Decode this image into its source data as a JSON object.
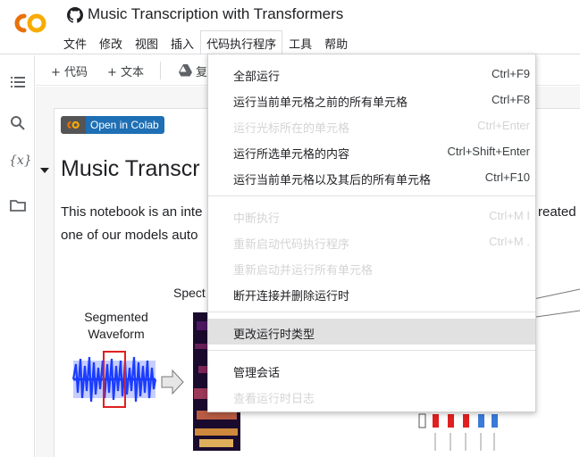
{
  "header": {
    "title": "Music Transcription with Transformers",
    "menu": [
      "文件",
      "修改",
      "视图",
      "插入",
      "代码执行程序",
      "工具",
      "帮助"
    ],
    "active_menu_index": 4
  },
  "toolbar": {
    "add_code": "+ 代码",
    "add_text": "+ 文本",
    "copy_to_drive": "复"
  },
  "rail": {
    "var_icon_text": "{x}"
  },
  "notebook": {
    "badge_text": "Open in Colab",
    "heading": "Music Transcr",
    "para_line1_left": "This notebook is an inte",
    "para_line1_right": "reated",
    "para_line2": "one of our models auto",
    "fig_label_segmented": "Segmented Waveform",
    "fig_label_spect": "Spect"
  },
  "dropdown": {
    "groups": [
      [
        {
          "label": "全部运行",
          "shortcut": "Ctrl+F9",
          "disabled": false
        },
        {
          "label": "运行当前单元格之前的所有单元格",
          "shortcut": "Ctrl+F8",
          "disabled": false
        },
        {
          "label": "运行光标所在的单元格",
          "shortcut": "Ctrl+Enter",
          "disabled": true
        },
        {
          "label": "运行所选单元格的内容",
          "shortcut": "Ctrl+Shift+Enter",
          "disabled": false
        },
        {
          "label": "运行当前单元格以及其后的所有单元格",
          "shortcut": "Ctrl+F10",
          "disabled": false
        }
      ],
      [
        {
          "label": "中断执行",
          "shortcut": "Ctrl+M I",
          "disabled": true
        },
        {
          "label": "重新启动代码执行程序",
          "shortcut": "Ctrl+M .",
          "disabled": true
        },
        {
          "label": "重新启动并运行所有单元格",
          "shortcut": "",
          "disabled": true
        },
        {
          "label": "断开连接并删除运行时",
          "shortcut": "",
          "disabled": false
        }
      ],
      [
        {
          "label": "更改运行时类型",
          "shortcut": "",
          "disabled": false,
          "hovered": true
        }
      ],
      [
        {
          "label": "管理会话",
          "shortcut": "",
          "disabled": false
        },
        {
          "label": "查看运行时日志",
          "shortcut": "",
          "disabled": true
        }
      ]
    ]
  },
  "colors": {
    "logo_orange": "#f9ab00",
    "logo_dark_orange": "#e8710a",
    "badge_blue": "#1e6fb4",
    "waveform_blue": "#1a3cff",
    "highlight_red": "#e02020"
  }
}
